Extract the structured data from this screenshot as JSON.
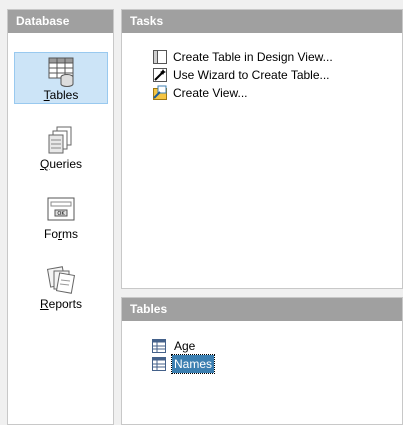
{
  "database": {
    "header": "Database",
    "items": [
      {
        "pre": "",
        "mn": "T",
        "post": "ables",
        "icon": "tables-icon",
        "selected": true
      },
      {
        "pre": "",
        "mn": "Q",
        "post": "ueries",
        "icon": "queries-icon",
        "selected": false
      },
      {
        "pre": "Fo",
        "mn": "r",
        "post": "ms",
        "icon": "forms-icon",
        "selected": false
      },
      {
        "pre": "",
        "mn": "R",
        "post": "eports",
        "icon": "reports-icon",
        "selected": false
      }
    ]
  },
  "tasks": {
    "header": "Tasks",
    "items": [
      {
        "label": "Create Table in Design View...",
        "icon": "table-design-icon"
      },
      {
        "label": "Use Wizard to Create Table...",
        "icon": "wizard-icon"
      },
      {
        "label": "Create View...",
        "icon": "create-view-icon"
      }
    ]
  },
  "tables": {
    "header": "Tables",
    "items": [
      {
        "label": "Age",
        "icon": "table-icon",
        "selected": false
      },
      {
        "label": "Names",
        "icon": "table-icon",
        "selected": true
      }
    ]
  },
  "colors": {
    "header_bg": "#a0a0a0",
    "selected_bg": "#cce4f7",
    "selected_border": "#99c9ef",
    "selection_highlight": "#3c7fb1"
  }
}
